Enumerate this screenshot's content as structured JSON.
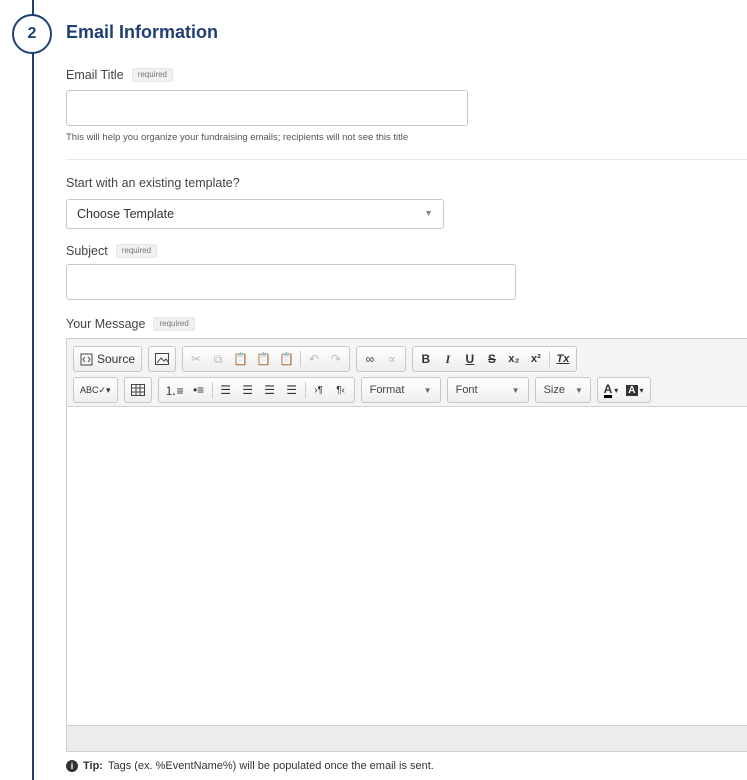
{
  "step": {
    "number": "2",
    "title": "Email Information"
  },
  "email_title": {
    "label": "Email Title",
    "required": "required",
    "value": "",
    "help": "This will help you organize your fundraising emails; recipients will not see this title"
  },
  "template": {
    "label": "Start with an existing template?",
    "selected": "Choose Template"
  },
  "subject": {
    "label": "Subject",
    "required": "required",
    "value": ""
  },
  "message": {
    "label": "Your Message",
    "required": "required"
  },
  "toolbar": {
    "source": "Source",
    "format": "Format",
    "font": "Font",
    "size": "Size",
    "bold": "B",
    "italic": "I",
    "underline": "U",
    "strike": "S",
    "subscript": "x₂",
    "superscript": "x²",
    "remove_format": "Tx",
    "text_color": "A",
    "bg_color": "A"
  },
  "tip": {
    "bold": "Tip:",
    "text": "Tags (ex. %EventName%) will be populated once the email is sent."
  },
  "colors": {
    "accent": "#1f3f73"
  }
}
